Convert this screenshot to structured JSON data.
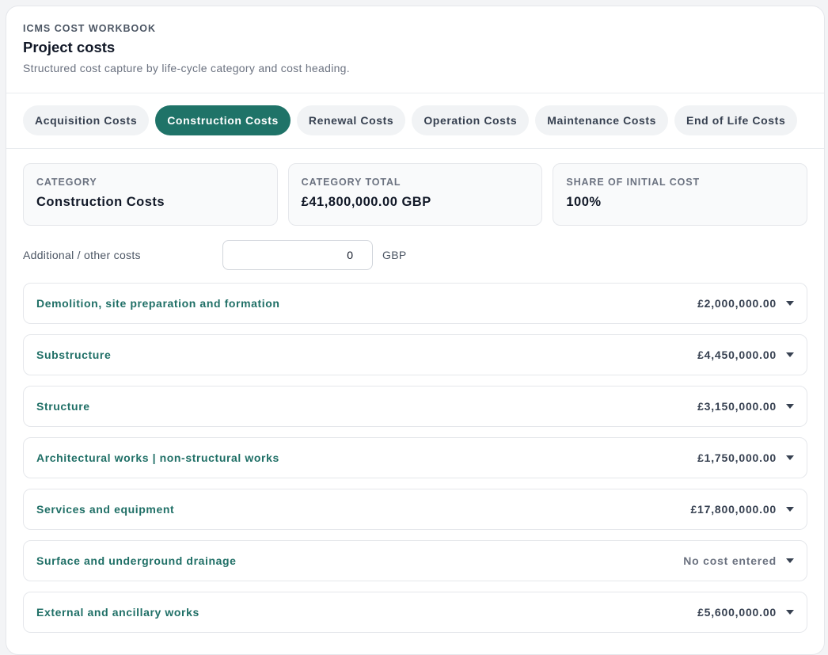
{
  "header": {
    "eyebrow": "ICMS COST WORKBOOK",
    "title": "Project costs",
    "subtitle": "Structured cost capture by life-cycle category and cost heading."
  },
  "tabs": [
    {
      "label": "Acquisition Costs",
      "active": false
    },
    {
      "label": "Construction Costs",
      "active": true
    },
    {
      "label": "Renewal Costs",
      "active": false
    },
    {
      "label": "Operation Costs",
      "active": false
    },
    {
      "label": "Maintenance Costs",
      "active": false
    },
    {
      "label": "End of Life Costs",
      "active": false
    }
  ],
  "stats": {
    "category": {
      "label": "CATEGORY",
      "value": "Construction Costs"
    },
    "total": {
      "label": "CATEGORY TOTAL",
      "value": "£41,800,000.00 GBP"
    },
    "share": {
      "label": "SHARE OF INITIAL COST",
      "value": "100%"
    }
  },
  "additional": {
    "label": "Additional / other costs",
    "value": "0",
    "unit": "GBP"
  },
  "headings": [
    {
      "name": "Demolition, site preparation and formation",
      "amount": "£2,000,000.00"
    },
    {
      "name": "Substructure",
      "amount": "£4,450,000.00"
    },
    {
      "name": "Structure",
      "amount": "£3,150,000.00"
    },
    {
      "name": "Architectural works | non-structural works",
      "amount": "£1,750,000.00"
    },
    {
      "name": "Services and equipment",
      "amount": "£17,800,000.00"
    },
    {
      "name": "Surface and underground drainage",
      "amount": "No cost entered"
    },
    {
      "name": "External and ancillary works",
      "amount": "£5,600,000.00"
    }
  ],
  "colors": {
    "accent": "#1f7368",
    "heading_text": "#1f6f66"
  }
}
